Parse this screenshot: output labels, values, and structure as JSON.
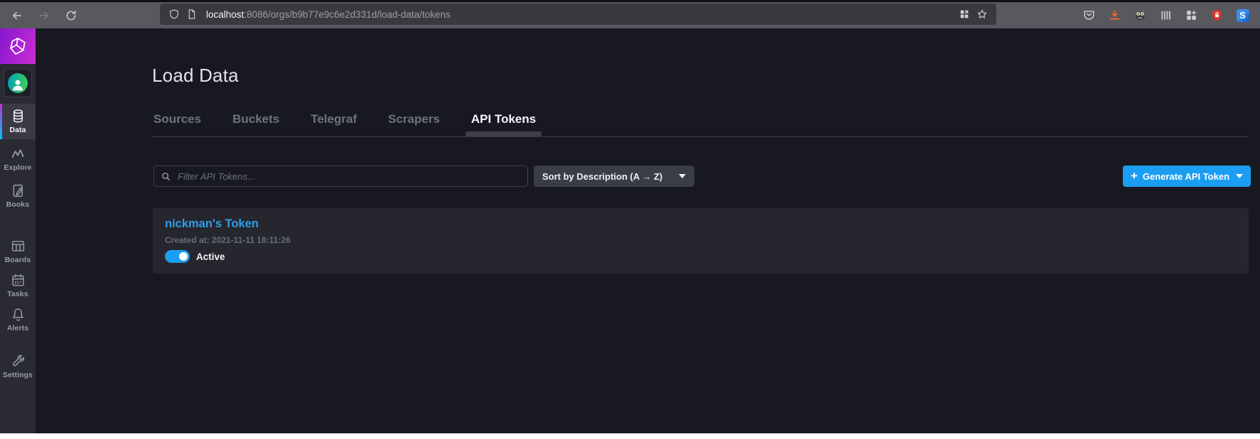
{
  "browser": {
    "url": {
      "host": "localhost",
      "path": ":8086/orgs/b9b77e9c6e2d331d/load-data/tokens"
    }
  },
  "sidebar": {
    "items": [
      {
        "label": "Data",
        "active": true
      },
      {
        "label": "Explore",
        "active": false
      },
      {
        "label": "Books",
        "active": false
      },
      {
        "label": "Boards",
        "active": false
      },
      {
        "label": "Tasks",
        "active": false
      },
      {
        "label": "Alerts",
        "active": false
      },
      {
        "label": "Settings",
        "active": false
      }
    ]
  },
  "page": {
    "title": "Load Data",
    "tabs": [
      {
        "label": "Sources",
        "active": false
      },
      {
        "label": "Buckets",
        "active": false
      },
      {
        "label": "Telegraf",
        "active": false
      },
      {
        "label": "Scrapers",
        "active": false
      },
      {
        "label": "API Tokens",
        "active": true
      }
    ],
    "controls": {
      "filter_placeholder": "Filter API Tokens...",
      "sort_label": "Sort by Description (A → Z)",
      "generate_label": "Generate API Token"
    },
    "tokens": [
      {
        "name": "nickman's Token",
        "created": "Created at: 2021-11-11 18:11:26",
        "status_label": "Active",
        "active": true
      }
    ]
  },
  "icons": {
    "back": "left-arrow",
    "forward": "right-arrow",
    "reload": "circular-arrow",
    "shield": "tracking-protection-shield",
    "page": "document-outline",
    "containers": "grid-with-arrow",
    "bookmark": "star-outline",
    "pocket": "pocket-chevron",
    "download": "orange-down-arrow-tray",
    "extensions": [
      "animal-face",
      "fence-bars",
      "grid-plus",
      "red-shield-lock",
      "blue-s-badge"
    ],
    "search": "magnifier",
    "logo": "influxdb-cube",
    "avatar": "person-silhouette"
  },
  "colors": {
    "accent_blue": "#1b9ef2",
    "link_blue": "#2f9fe6",
    "page_bg": "#181822",
    "sidebar_bg": "#2a2a32",
    "card_bg": "#26262e",
    "toolbar_bg": "#58585f",
    "urlbar_bg": "#39393f",
    "download_orange": "#ef6c2d",
    "logo_gradient_start": "#8417cf",
    "logo_gradient_end": "#cb2ed4",
    "active_stripe_top": "#bf2fd6",
    "active_stripe_bottom": "#00c2ff"
  }
}
